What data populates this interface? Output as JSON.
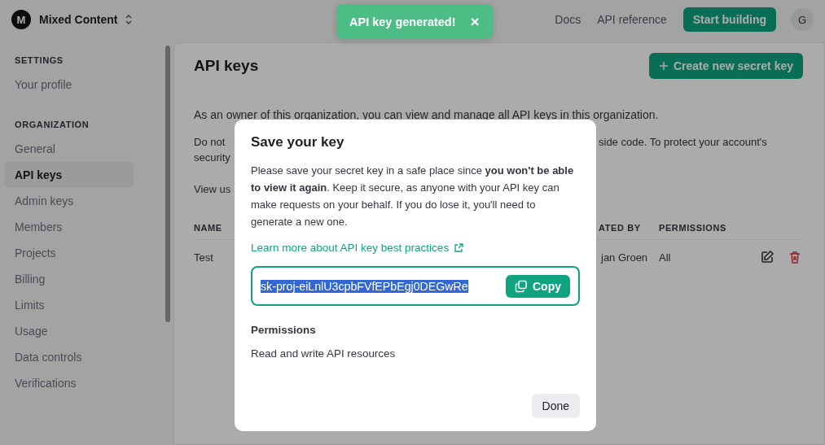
{
  "header": {
    "org_initial": "M",
    "org_name": "Mixed Content",
    "links": [
      "Docs",
      "API reference"
    ],
    "primary_button": "Start building",
    "user_initial": "G"
  },
  "toast": {
    "text": "API key generated!",
    "close": "×"
  },
  "sidebar": {
    "sections": [
      {
        "heading": "SETTINGS",
        "items": [
          {
            "label": "Your profile",
            "selected": false
          }
        ]
      },
      {
        "heading": "ORGANIZATION",
        "items": [
          {
            "label": "General",
            "selected": false
          },
          {
            "label": "API keys",
            "selected": true
          },
          {
            "label": "Admin keys",
            "selected": false
          },
          {
            "label": "Members",
            "selected": false
          },
          {
            "label": "Projects",
            "selected": false
          },
          {
            "label": "Billing",
            "selected": false
          },
          {
            "label": "Limits",
            "selected": false
          },
          {
            "label": "Usage",
            "selected": false
          },
          {
            "label": "Data controls",
            "selected": false
          },
          {
            "label": "Verifications",
            "selected": false
          }
        ]
      }
    ]
  },
  "page": {
    "title": "API keys",
    "create_button": "Create new secret key",
    "intro": "As an owner of this organization, you can view and manage all API keys in this organization.",
    "notice_left": "Do not",
    "notice_right": "side code. To protect your account's",
    "notice_line2": "security",
    "usage_left": "View us",
    "table": {
      "columns": [
        "NAME",
        "ATED BY",
        "PERMISSIONS"
      ],
      "rows": [
        {
          "name": "Test",
          "created_by": "jan Groen",
          "permissions": "All"
        }
      ]
    }
  },
  "dialog": {
    "title": "Save your key",
    "body": "Please save your secret key in a safe place since **you won't be able to view it again**. Keep it secure, as anyone with your API key can make requests on your behalf. If you do lose it, you'll need to generate a new one.",
    "link": "Learn more about API key best practices",
    "key_field": {
      "value": "sk-proj-eiLnlU3cpbFVfEPbEgj0DEGwRe",
      "selected": true
    },
    "copy_button": "Copy",
    "permissions_label": "Permissions",
    "permissions_value": "Read and write API resources",
    "done_button": "Done"
  }
}
